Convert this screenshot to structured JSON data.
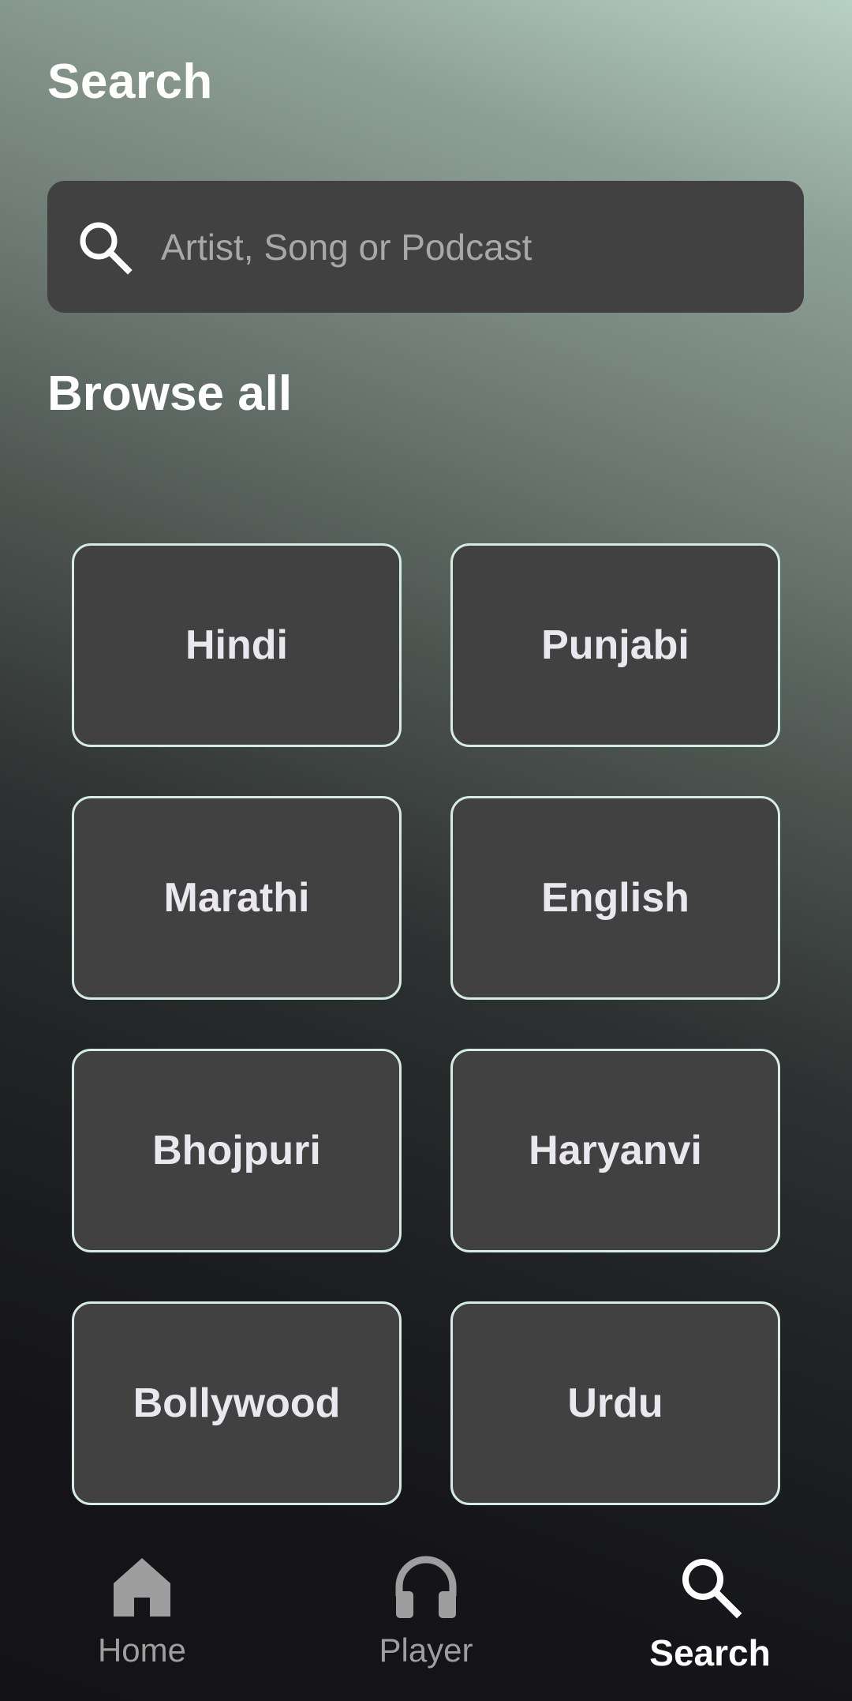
{
  "header": {
    "title": "Search"
  },
  "search": {
    "placeholder": "Artist, Song or Podcast",
    "value": ""
  },
  "browse": {
    "title": "Browse all",
    "categories": [
      {
        "label": "Hindi"
      },
      {
        "label": "Punjabi"
      },
      {
        "label": "Marathi"
      },
      {
        "label": "English"
      },
      {
        "label": "Bhojpuri"
      },
      {
        "label": "Haryanvi"
      },
      {
        "label": "Bollywood"
      },
      {
        "label": "Urdu"
      }
    ]
  },
  "bottom_nav": {
    "items": [
      {
        "label": "Home",
        "icon": "home-icon",
        "active": false
      },
      {
        "label": "Player",
        "icon": "headphones-icon",
        "active": false
      },
      {
        "label": "Search",
        "icon": "search-icon",
        "active": true
      }
    ]
  },
  "colors": {
    "card_background": "#414141",
    "card_border": "#d6ece3",
    "nav_inactive": "#9e9e9e",
    "nav_active": "#ffffff"
  }
}
